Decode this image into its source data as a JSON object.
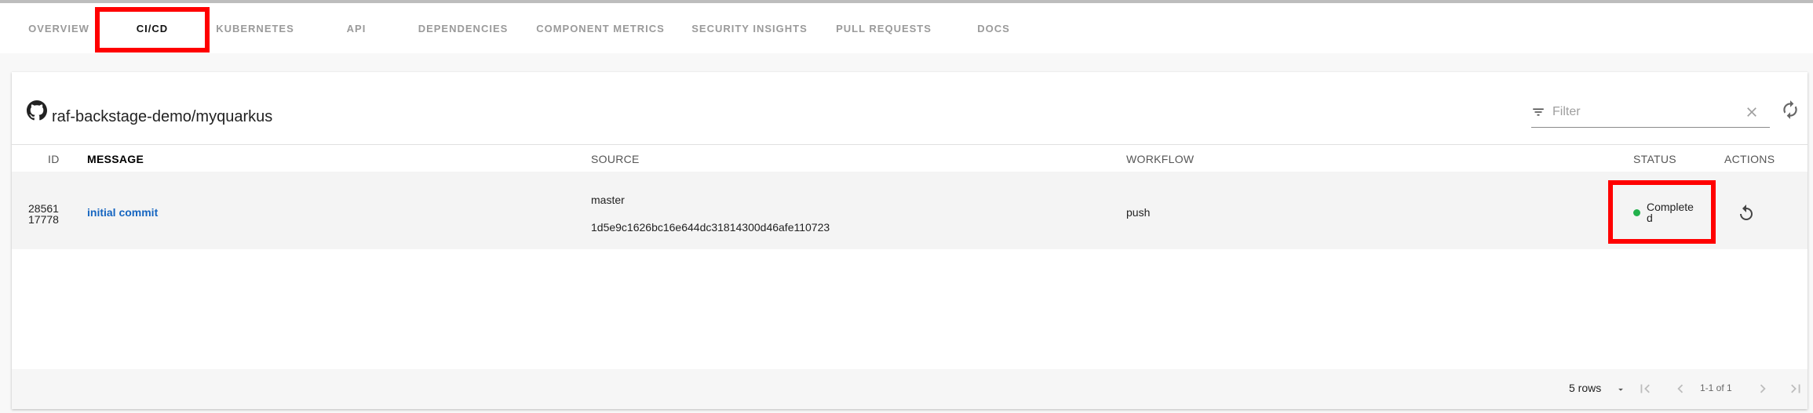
{
  "tabs": [
    {
      "label": "OVERVIEW"
    },
    {
      "label": "CI/CD"
    },
    {
      "label": "KUBERNETES"
    },
    {
      "label": "API"
    },
    {
      "label": "DEPENDENCIES"
    },
    {
      "label": "COMPONENT METRICS"
    },
    {
      "label": "SECURITY INSIGHTS"
    },
    {
      "label": "PULL REQUESTS"
    },
    {
      "label": "DOCS"
    }
  ],
  "card": {
    "title": "raf-backstage-demo/myquarkus",
    "filter_placeholder": "Filter"
  },
  "table": {
    "columns": {
      "id": "ID",
      "message": "MESSAGE",
      "source": "SOURCE",
      "workflow": "WORKFLOW",
      "status": "STATUS",
      "actions": "ACTIONS"
    },
    "rows": [
      {
        "id": "2856117778",
        "message": "initial commit",
        "branch": "master",
        "sha": "1d5e9c1626bc16e644dc31814300d46afe110723",
        "workflow": "push",
        "status": "Completed"
      }
    ]
  },
  "pagination": {
    "rows_per_page": "5 rows",
    "range": "1-1 of 1"
  },
  "colors": {
    "accent": "#3f51b5",
    "link": "#1565c0",
    "status_success": "#22b14c",
    "highlight": "#ff0000"
  },
  "icons": {
    "repo": "github-icon",
    "filter": "filter-icon",
    "clear": "close-icon",
    "refresh": "refresh-icon",
    "rerun": "replay-icon"
  }
}
